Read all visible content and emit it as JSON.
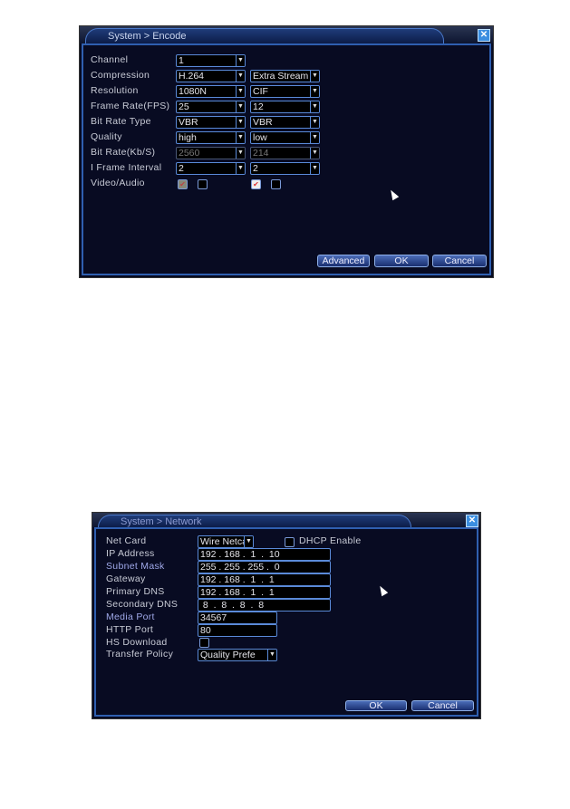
{
  "encode": {
    "title": "System > Encode",
    "rows": [
      {
        "label": "Channel",
        "main": "1"
      },
      {
        "label": "Compression",
        "main": "H.264",
        "extra": "Extra Stream"
      },
      {
        "label": "Resolution",
        "main": "1080N",
        "extra": "CIF"
      },
      {
        "label": "Frame Rate(FPS)",
        "main": "25",
        "extra": "12"
      },
      {
        "label": "Bit Rate Type",
        "main": "VBR",
        "extra": "VBR"
      },
      {
        "label": "Quality",
        "main": "high",
        "extra": "low"
      },
      {
        "label": "Bit Rate(Kb/S)",
        "main": "2560",
        "extra": "214"
      },
      {
        "label": "I Frame Interval",
        "main": " 2",
        "extra": " 2"
      }
    ],
    "video_audio_label": "Video/Audio",
    "buttons": {
      "advanced": "Advanced",
      "ok": "OK",
      "cancel": "Cancel"
    }
  },
  "network": {
    "title": "System > Network",
    "net_card_label": "Net Card",
    "net_card": "Wire Netcard",
    "dhcp_label": "DHCP Enable",
    "ip_rows": [
      {
        "label": "IP Address",
        "value": "192 . 168 .  1  .  10"
      },
      {
        "label": "Subnet Mask",
        "value": "255 . 255 . 255 .  0"
      },
      {
        "label": "Gateway",
        "value": "192 . 168 .  1  .  1"
      },
      {
        "label": "Primary DNS",
        "value": "192 . 168 .  1  .  1"
      },
      {
        "label": "Secondary DNS",
        "value": " 8  .  8  .  8  .  8"
      }
    ],
    "media_port_label": "Media Port",
    "media_port": "34567",
    "http_port_label": "HTTP Port",
    "http_port": "80",
    "hs_download_label": "HS Download",
    "transfer_policy_label": "Transfer Policy",
    "transfer_policy": "Quality Prefe",
    "buttons": {
      "ok": "OK",
      "cancel": "Cancel"
    }
  }
}
